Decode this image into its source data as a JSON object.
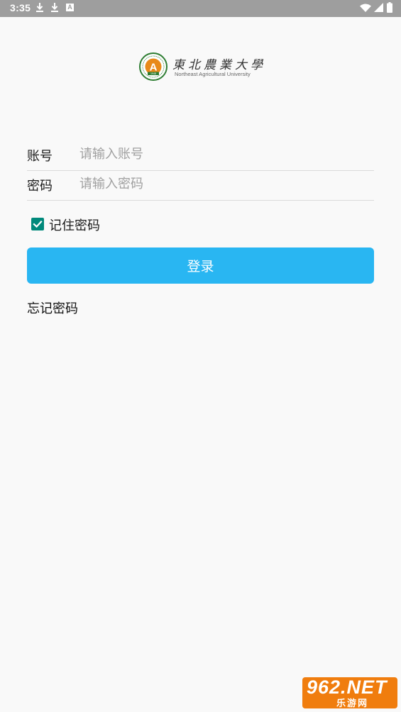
{
  "status_bar": {
    "time": "3:35",
    "icons": [
      "download-icon",
      "download-icon",
      "a-notification-icon",
      "wifi-icon",
      "signal-icon",
      "battery-icon"
    ],
    "a_icon_text": "A"
  },
  "logo": {
    "name_cn": "東北農業大學",
    "name_en": "Northeast Agricultural University",
    "emblem_letter": "A",
    "emblem_year": "1948"
  },
  "form": {
    "account": {
      "label": "账号",
      "placeholder": "请输入账号",
      "value": ""
    },
    "password": {
      "label": "密码",
      "placeholder": "请输入密码",
      "value": ""
    },
    "remember": {
      "label": "记住密码",
      "checked": true
    },
    "login_label": "登录",
    "forgot_label": "忘记密码"
  },
  "watermark": {
    "main": "962.NET",
    "sub": "乐游网"
  },
  "colors": {
    "status_bar": "#9e9e9e",
    "background": "#f9f9f9",
    "primary_button": "#29b6f2",
    "checkbox": "#00897b",
    "divider": "#dadada",
    "emblem_green": "#2e7d32",
    "emblem_orange": "#e88a1a",
    "watermark": "#f07d0e"
  }
}
